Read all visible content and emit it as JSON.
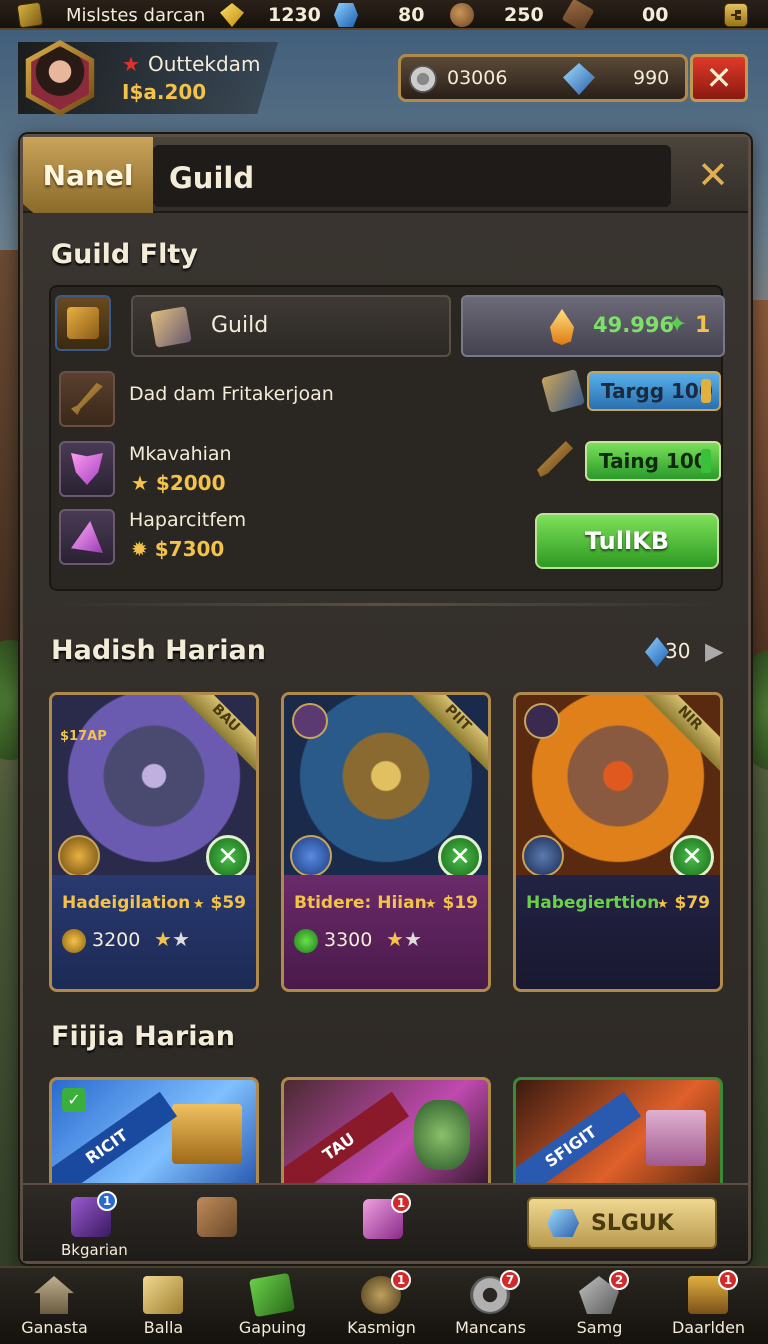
{
  "topbar": {
    "title": "Mislstes darcan",
    "resources": [
      {
        "icon": "gold-gem-icon",
        "value": "1230"
      },
      {
        "icon": "blue-gem-icon",
        "value": "80"
      },
      {
        "icon": "cookie-icon",
        "value": "250"
      },
      {
        "icon": "wood-icon",
        "value": "00"
      }
    ]
  },
  "profile": {
    "name": "Outtekdam",
    "cash": "I$a.200"
  },
  "currency": {
    "primary": "03006",
    "secondary": "990"
  },
  "panel": {
    "tab_label": "Nanel",
    "title": "Guild",
    "guild_section": {
      "heading": "Guild Flty",
      "guild_button_label": "Guild",
      "value_amount": "49.996",
      "value_count": "1",
      "rows": [
        {
          "label": "Dad dam Fritakerjoan",
          "price": ""
        },
        {
          "label": "Mkavahian",
          "price": "$2000"
        },
        {
          "label": "Haparcitfem",
          "price": "$7300"
        }
      ],
      "pill_blue_label": "Targg 100",
      "pill_green_label": "Taing 100",
      "action_button_label": "TullKB"
    },
    "heroes_section": {
      "heading": "Hadish Harian",
      "count": "30",
      "cards": [
        {
          "tag": "$17AP",
          "banner": "BAU",
          "name": "Hadeigilation",
          "price": "$59",
          "value": "3200",
          "name_color": "#f2c24a"
        },
        {
          "tag": "",
          "banner": "PIIT",
          "name": "Btidere: Hiian",
          "price": "$19",
          "value": "3300",
          "name_color": "#f2c24a"
        },
        {
          "tag": "",
          "banner": "NIR",
          "name": "Habegierttion",
          "price": "$79",
          "value": "",
          "name_color": "#6ad04a"
        }
      ]
    },
    "bundles_section": {
      "heading": "Fiijia Harian",
      "cards": [
        {
          "ribbon": "RICIT"
        },
        {
          "ribbon": "TAU"
        },
        {
          "ribbon": "SFIGIT"
        }
      ]
    },
    "footer": {
      "item1_label": "Bkgarian",
      "item1_badge": "1",
      "item3_badge": "1",
      "cta_label": "SLGUK"
    }
  },
  "bottom_nav": [
    {
      "label": "Ganasta",
      "icon": "house-icon",
      "badge": ""
    },
    {
      "label": "Balla",
      "icon": "scroll-icon",
      "badge": ""
    },
    {
      "label": "Gapuing",
      "icon": "map-icon",
      "badge": ""
    },
    {
      "label": "Kasmign",
      "icon": "ball-icon",
      "badge": "1"
    },
    {
      "label": "Mancans",
      "icon": "gear-icon",
      "badge": "7"
    },
    {
      "label": "Samg",
      "icon": "hammer-icon",
      "badge": "2"
    },
    {
      "label": "Daarlden",
      "icon": "chest-icon",
      "badge": "1"
    }
  ]
}
